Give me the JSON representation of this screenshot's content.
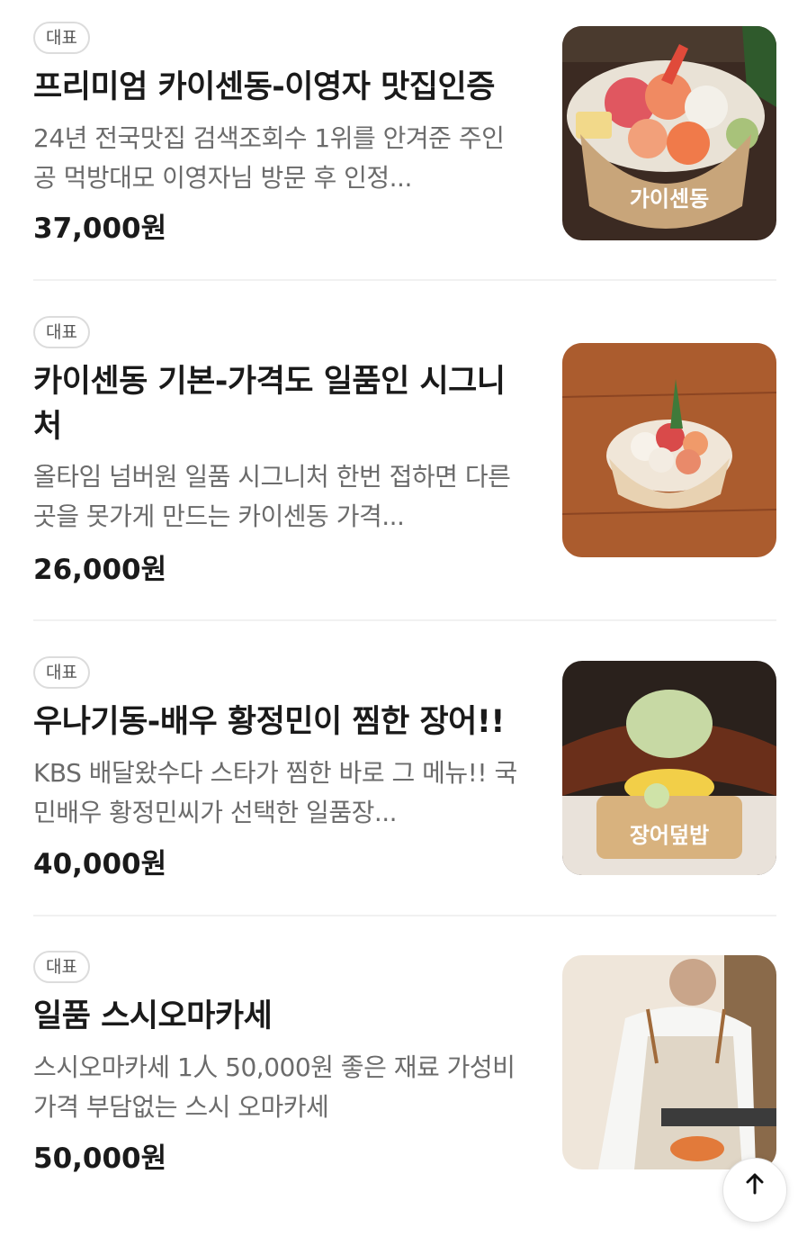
{
  "menu": {
    "items": [
      {
        "badge": "대표",
        "title": "프리미엄 카이센동-이영자 맛집인증",
        "description": "24년 전국맛집 검색조회수 1위를 안겨준 주인공 먹방대모 이영자님 방문 후 인정...",
        "price": "37,000원",
        "image_caption": "가이센동"
      },
      {
        "badge": "대표",
        "title": "카이센동 기본-가격도 일품인 시그니처",
        "description": "올타임 넘버원 일품 시그니처 한번 접하면 다른 곳을 못가게 만드는 카이센동 가격...",
        "price": "26,000원"
      },
      {
        "badge": "대표",
        "title": "우나기동-배우 황정민이 찜한 장어!!",
        "description": "KBS 배달왔수다 스타가 찜한 바로 그 메뉴!! 국민배우 황정민씨가 선택한 일품장...",
        "price": "40,000원",
        "image_caption": "장어덮밥"
      },
      {
        "badge": "대표",
        "title": "일품 스시오마카세",
        "description": "스시오마카세 1人 50,000원 좋은 재료 가성비 가격 부담없는 스시 오마카세",
        "price": "50,000원"
      }
    ]
  },
  "scroll_top": {
    "icon": "arrow-up-icon"
  }
}
